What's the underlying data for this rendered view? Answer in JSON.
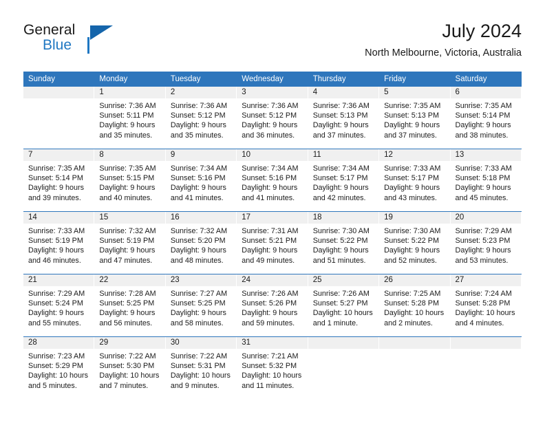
{
  "brand": {
    "name_part1": "General",
    "name_part2": "Blue",
    "logo_icon": "general-blue-triangle-logo"
  },
  "header": {
    "title": "July 2024",
    "location": "North Melbourne, Victoria, Australia"
  },
  "colors": {
    "header_blue": "#2e76bc",
    "daynum_band": "#f0f0f0",
    "text": "#1a1a1a",
    "brand_blue": "#1f77c2"
  },
  "weekday_headers": [
    "Sunday",
    "Monday",
    "Tuesday",
    "Wednesday",
    "Thursday",
    "Friday",
    "Saturday"
  ],
  "weeks": [
    [
      {
        "day": "",
        "sunrise": "",
        "sunset": "",
        "daylight_line1": "",
        "daylight_line2": "",
        "empty": true
      },
      {
        "day": "1",
        "sunrise": "Sunrise: 7:36 AM",
        "sunset": "Sunset: 5:11 PM",
        "daylight_line1": "Daylight: 9 hours",
        "daylight_line2": "and 35 minutes."
      },
      {
        "day": "2",
        "sunrise": "Sunrise: 7:36 AM",
        "sunset": "Sunset: 5:12 PM",
        "daylight_line1": "Daylight: 9 hours",
        "daylight_line2": "and 35 minutes."
      },
      {
        "day": "3",
        "sunrise": "Sunrise: 7:36 AM",
        "sunset": "Sunset: 5:12 PM",
        "daylight_line1": "Daylight: 9 hours",
        "daylight_line2": "and 36 minutes."
      },
      {
        "day": "4",
        "sunrise": "Sunrise: 7:36 AM",
        "sunset": "Sunset: 5:13 PM",
        "daylight_line1": "Daylight: 9 hours",
        "daylight_line2": "and 37 minutes."
      },
      {
        "day": "5",
        "sunrise": "Sunrise: 7:35 AM",
        "sunset": "Sunset: 5:13 PM",
        "daylight_line1": "Daylight: 9 hours",
        "daylight_line2": "and 37 minutes."
      },
      {
        "day": "6",
        "sunrise": "Sunrise: 7:35 AM",
        "sunset": "Sunset: 5:14 PM",
        "daylight_line1": "Daylight: 9 hours",
        "daylight_line2": "and 38 minutes."
      }
    ],
    [
      {
        "day": "7",
        "sunrise": "Sunrise: 7:35 AM",
        "sunset": "Sunset: 5:14 PM",
        "daylight_line1": "Daylight: 9 hours",
        "daylight_line2": "and 39 minutes."
      },
      {
        "day": "8",
        "sunrise": "Sunrise: 7:35 AM",
        "sunset": "Sunset: 5:15 PM",
        "daylight_line1": "Daylight: 9 hours",
        "daylight_line2": "and 40 minutes."
      },
      {
        "day": "9",
        "sunrise": "Sunrise: 7:34 AM",
        "sunset": "Sunset: 5:16 PM",
        "daylight_line1": "Daylight: 9 hours",
        "daylight_line2": "and 41 minutes."
      },
      {
        "day": "10",
        "sunrise": "Sunrise: 7:34 AM",
        "sunset": "Sunset: 5:16 PM",
        "daylight_line1": "Daylight: 9 hours",
        "daylight_line2": "and 41 minutes."
      },
      {
        "day": "11",
        "sunrise": "Sunrise: 7:34 AM",
        "sunset": "Sunset: 5:17 PM",
        "daylight_line1": "Daylight: 9 hours",
        "daylight_line2": "and 42 minutes."
      },
      {
        "day": "12",
        "sunrise": "Sunrise: 7:33 AM",
        "sunset": "Sunset: 5:17 PM",
        "daylight_line1": "Daylight: 9 hours",
        "daylight_line2": "and 43 minutes."
      },
      {
        "day": "13",
        "sunrise": "Sunrise: 7:33 AM",
        "sunset": "Sunset: 5:18 PM",
        "daylight_line1": "Daylight: 9 hours",
        "daylight_line2": "and 45 minutes."
      }
    ],
    [
      {
        "day": "14",
        "sunrise": "Sunrise: 7:33 AM",
        "sunset": "Sunset: 5:19 PM",
        "daylight_line1": "Daylight: 9 hours",
        "daylight_line2": "and 46 minutes."
      },
      {
        "day": "15",
        "sunrise": "Sunrise: 7:32 AM",
        "sunset": "Sunset: 5:19 PM",
        "daylight_line1": "Daylight: 9 hours",
        "daylight_line2": "and 47 minutes."
      },
      {
        "day": "16",
        "sunrise": "Sunrise: 7:32 AM",
        "sunset": "Sunset: 5:20 PM",
        "daylight_line1": "Daylight: 9 hours",
        "daylight_line2": "and 48 minutes."
      },
      {
        "day": "17",
        "sunrise": "Sunrise: 7:31 AM",
        "sunset": "Sunset: 5:21 PM",
        "daylight_line1": "Daylight: 9 hours",
        "daylight_line2": "and 49 minutes."
      },
      {
        "day": "18",
        "sunrise": "Sunrise: 7:30 AM",
        "sunset": "Sunset: 5:22 PM",
        "daylight_line1": "Daylight: 9 hours",
        "daylight_line2": "and 51 minutes."
      },
      {
        "day": "19",
        "sunrise": "Sunrise: 7:30 AM",
        "sunset": "Sunset: 5:22 PM",
        "daylight_line1": "Daylight: 9 hours",
        "daylight_line2": "and 52 minutes."
      },
      {
        "day": "20",
        "sunrise": "Sunrise: 7:29 AM",
        "sunset": "Sunset: 5:23 PM",
        "daylight_line1": "Daylight: 9 hours",
        "daylight_line2": "and 53 minutes."
      }
    ],
    [
      {
        "day": "21",
        "sunrise": "Sunrise: 7:29 AM",
        "sunset": "Sunset: 5:24 PM",
        "daylight_line1": "Daylight: 9 hours",
        "daylight_line2": "and 55 minutes."
      },
      {
        "day": "22",
        "sunrise": "Sunrise: 7:28 AM",
        "sunset": "Sunset: 5:25 PM",
        "daylight_line1": "Daylight: 9 hours",
        "daylight_line2": "and 56 minutes."
      },
      {
        "day": "23",
        "sunrise": "Sunrise: 7:27 AM",
        "sunset": "Sunset: 5:25 PM",
        "daylight_line1": "Daylight: 9 hours",
        "daylight_line2": "and 58 minutes."
      },
      {
        "day": "24",
        "sunrise": "Sunrise: 7:26 AM",
        "sunset": "Sunset: 5:26 PM",
        "daylight_line1": "Daylight: 9 hours",
        "daylight_line2": "and 59 minutes."
      },
      {
        "day": "25",
        "sunrise": "Sunrise: 7:26 AM",
        "sunset": "Sunset: 5:27 PM",
        "daylight_line1": "Daylight: 10 hours",
        "daylight_line2": "and 1 minute."
      },
      {
        "day": "26",
        "sunrise": "Sunrise: 7:25 AM",
        "sunset": "Sunset: 5:28 PM",
        "daylight_line1": "Daylight: 10 hours",
        "daylight_line2": "and 2 minutes."
      },
      {
        "day": "27",
        "sunrise": "Sunrise: 7:24 AM",
        "sunset": "Sunset: 5:28 PM",
        "daylight_line1": "Daylight: 10 hours",
        "daylight_line2": "and 4 minutes."
      }
    ],
    [
      {
        "day": "28",
        "sunrise": "Sunrise: 7:23 AM",
        "sunset": "Sunset: 5:29 PM",
        "daylight_line1": "Daylight: 10 hours",
        "daylight_line2": "and 5 minutes."
      },
      {
        "day": "29",
        "sunrise": "Sunrise: 7:22 AM",
        "sunset": "Sunset: 5:30 PM",
        "daylight_line1": "Daylight: 10 hours",
        "daylight_line2": "and 7 minutes."
      },
      {
        "day": "30",
        "sunrise": "Sunrise: 7:22 AM",
        "sunset": "Sunset: 5:31 PM",
        "daylight_line1": "Daylight: 10 hours",
        "daylight_line2": "and 9 minutes."
      },
      {
        "day": "31",
        "sunrise": "Sunrise: 7:21 AM",
        "sunset": "Sunset: 5:32 PM",
        "daylight_line1": "Daylight: 10 hours",
        "daylight_line2": "and 11 minutes."
      },
      {
        "day": "",
        "sunrise": "",
        "sunset": "",
        "daylight_line1": "",
        "daylight_line2": "",
        "empty": true
      },
      {
        "day": "",
        "sunrise": "",
        "sunset": "",
        "daylight_line1": "",
        "daylight_line2": "",
        "empty": true
      },
      {
        "day": "",
        "sunrise": "",
        "sunset": "",
        "daylight_line1": "",
        "daylight_line2": "",
        "empty": true
      }
    ]
  ]
}
